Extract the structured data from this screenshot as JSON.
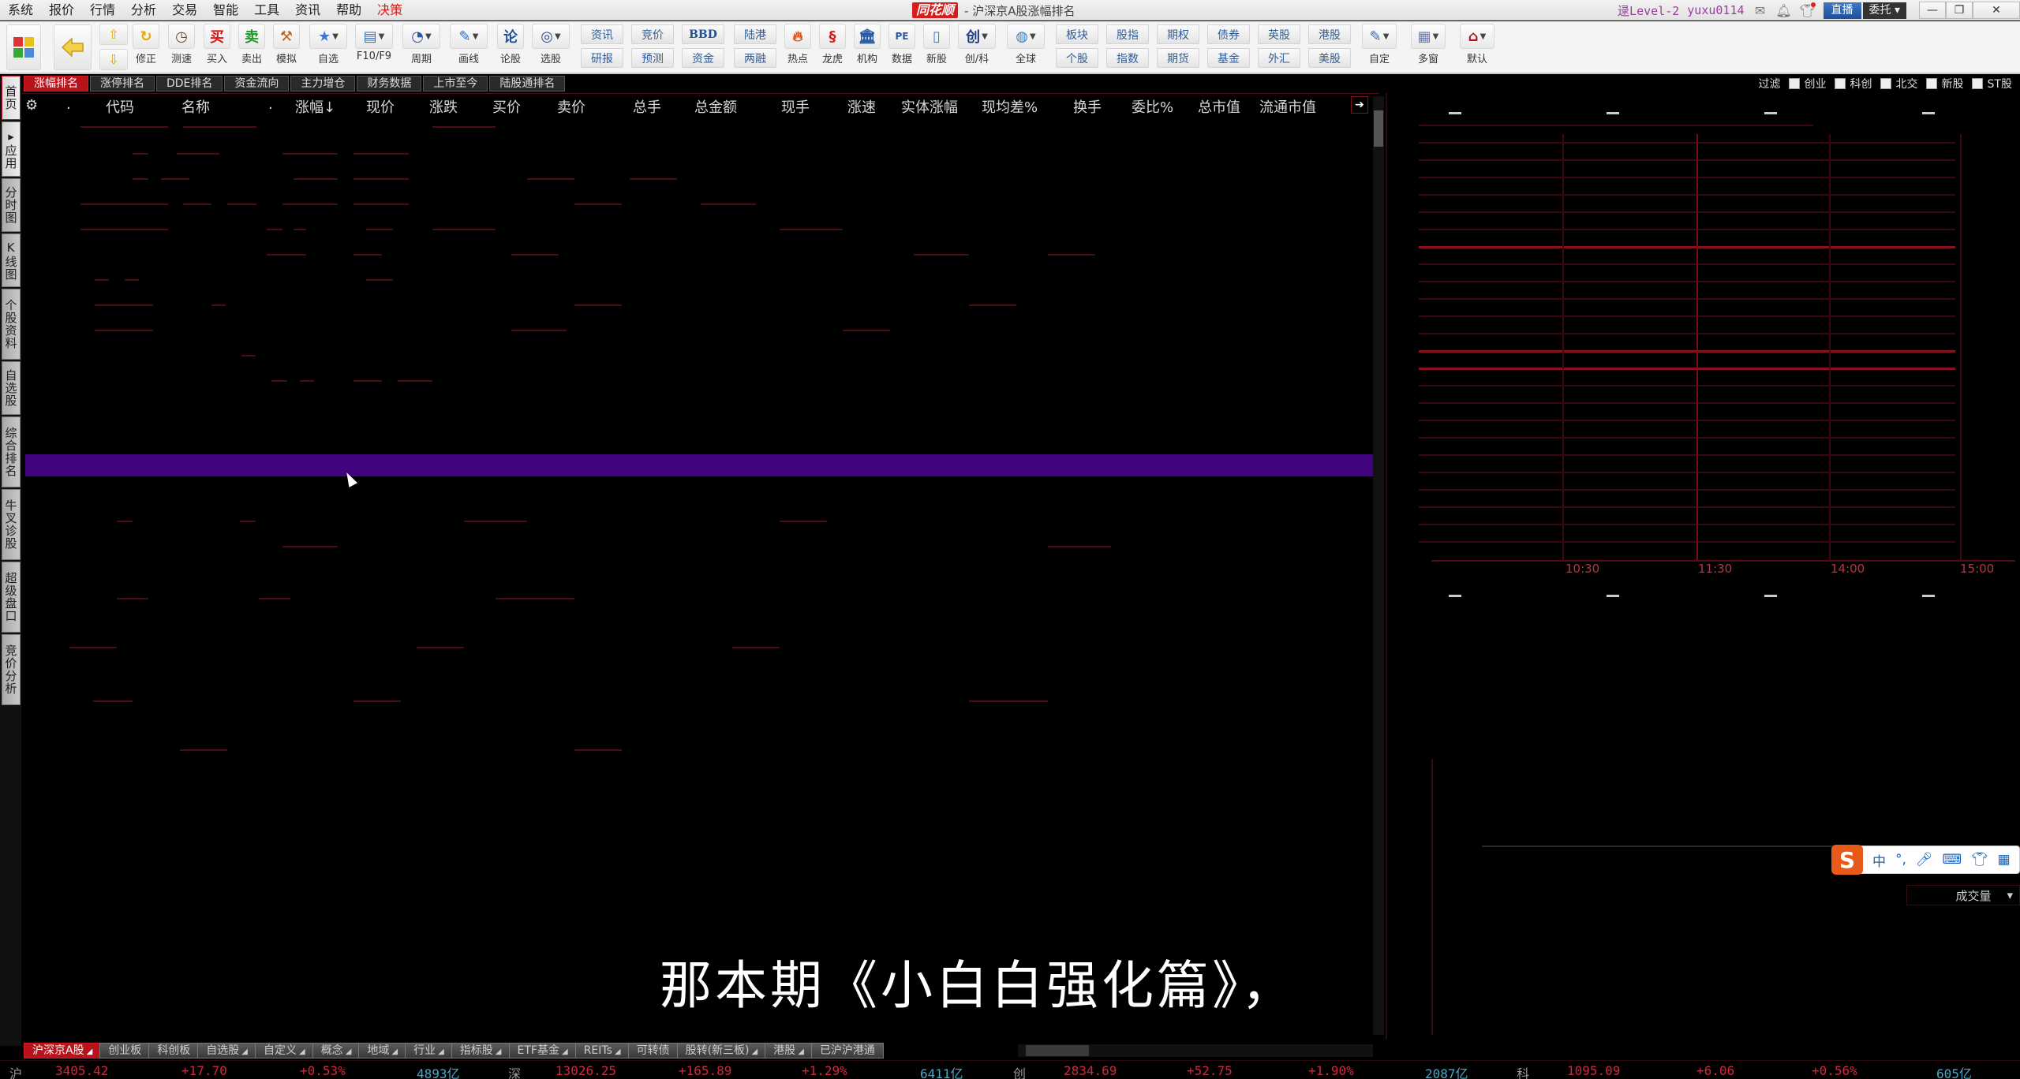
{
  "menubar": {
    "items": [
      "系统",
      "报价",
      "行情",
      "分析",
      "交易",
      "智能",
      "工具",
      "资讯",
      "帮助",
      "决策"
    ],
    "logo": "同花顺",
    "window_title": "- 沪深京A股涨幅排名",
    "level": "Level-2",
    "username": "yuxu0114",
    "live_button": "直播",
    "entrust_button": "委托",
    "minimize": "—",
    "restore": "❐",
    "close": "✕"
  },
  "toolbar": {
    "items": [
      {
        "icon": "home-grid-icon",
        "label": ""
      },
      {
        "icon": "back-arrow-icon",
        "label": ""
      },
      {
        "icon": "up-arrow-icon",
        "label": ""
      },
      {
        "icon": "down-arrow-icon",
        "label": ""
      },
      {
        "icon": "refresh-icon",
        "label": "修正"
      },
      {
        "icon": "clock-icon",
        "label": "测速"
      },
      {
        "icon": "buy-icon",
        "label": "买入",
        "glyph": "买"
      },
      {
        "icon": "sell-icon",
        "label": "卖出",
        "glyph": "卖"
      },
      {
        "icon": "gavel-icon",
        "label": "模拟"
      },
      {
        "icon": "star-folder-icon",
        "label": "自选"
      },
      {
        "icon": "f10-icon",
        "label": "F10/F9"
      },
      {
        "icon": "period-icon",
        "label": "周期"
      },
      {
        "icon": "pencil-icon",
        "label": "画线"
      },
      {
        "icon": "stock-forum-icon",
        "label": "论股",
        "glyph": "论"
      },
      {
        "icon": "stock-picker-icon",
        "label": "选股"
      }
    ],
    "text_buttons_top": [
      "资讯",
      "竞价",
      "BBD",
      "陆港",
      "板块",
      "股指",
      "期权",
      "债券",
      "英股",
      "港股"
    ],
    "text_buttons_bottom": [
      "研报",
      "预测",
      "资金",
      "两融",
      "个股",
      "指数",
      "期货",
      "基金",
      "外汇",
      "美股"
    ],
    "icon_buttons": [
      {
        "icon": "fire-icon",
        "label": "热点"
      },
      {
        "icon": "dragon-icon",
        "label": "龙虎"
      },
      {
        "icon": "bank-icon",
        "label": "机构"
      },
      {
        "icon": "pe-icon",
        "label": "数据",
        "glyph": "PE"
      },
      {
        "icon": "new-stock-icon",
        "label": "新股"
      },
      {
        "icon": "chuang-icon",
        "label": "创/科",
        "glyph": "创"
      },
      {
        "icon": "globe-icon",
        "label": "全球"
      }
    ],
    "right_buttons": [
      {
        "icon": "custom-icon",
        "label": "自定"
      },
      {
        "icon": "multi-window-icon",
        "label": "多窗"
      },
      {
        "icon": "house-icon",
        "label": "默认"
      }
    ]
  },
  "tabs": [
    "涨幅排名",
    "涨停排名",
    "DDE排名",
    "资金流向",
    "主力增仓",
    "财务数据",
    "上市至今",
    "陆股通排名"
  ],
  "active_tab": 0,
  "filters": {
    "label": "过滤",
    "options": [
      "创业",
      "科创",
      "北交",
      "新股",
      "ST股"
    ]
  },
  "sidebar": {
    "items": [
      "首页",
      "应用",
      "分时图",
      "K线图",
      "个股资料",
      "自选股",
      "综合排名",
      "牛叉诊股",
      "超级盘口",
      "竞价分析"
    ]
  },
  "table": {
    "columns": [
      ".",
      "代码",
      "名称",
      ".",
      "涨幅↓",
      "现价",
      "涨跌",
      "买价",
      "卖价",
      "总手",
      "总金额",
      "现手",
      "涨速",
      "实体涨幅",
      "现均差%",
      "换手",
      "委比%",
      "总市值",
      "流通市值"
    ]
  },
  "chart": {
    "time_labels": [
      "10:30",
      "11:30",
      "14:00",
      "15:00"
    ],
    "volume_selector": "成交量"
  },
  "ime": {
    "logo": "S",
    "items": [
      "中",
      "°,",
      "🎤",
      "⌨",
      "👕",
      "▦"
    ]
  },
  "subtitle": "那本期《小白白强化篇》，",
  "bottom_tabs": [
    "沪深京A股",
    "创业板",
    "科创板",
    "自选股",
    "自定义",
    "概念",
    "地域",
    "行业",
    "指标股",
    "ETF基金",
    "REITs",
    "可转债",
    "股转(新三板)",
    "港股",
    "已沪沪港通"
  ],
  "status": {
    "sh": {
      "label": "沪",
      "index": "3405.42",
      "change": "+17.70",
      "pct": "+0.53%",
      "amount": "4893亿"
    },
    "sz": {
      "label": "深",
      "index": "13026.25",
      "change": "+165.89",
      "pct": "+1.29%",
      "amount": "6411亿"
    },
    "cy": {
      "label": "创",
      "index": "2834.69",
      "change": "+52.75",
      "pct": "+1.90%",
      "amount": "2087亿"
    },
    "kc": {
      "label": "科",
      "index": "1095.09",
      "change": "+6.06",
      "pct": "+0.56%",
      "amount": "605亿"
    }
  }
}
